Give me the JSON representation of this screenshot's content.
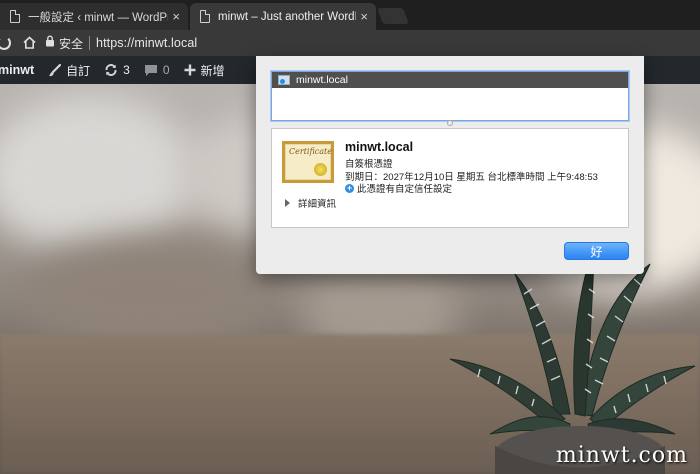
{
  "tabs": [
    {
      "title": "一般設定 ‹ minwt — WordPress",
      "close": "×",
      "active": false
    },
    {
      "title": "minwt – Just another WordPress",
      "close": "×",
      "active": true
    }
  ],
  "toolbar": {
    "secure_label": "安全",
    "url": "https://minwt.local"
  },
  "adminbar": {
    "site_name": "minwt",
    "customize_label": "自訂",
    "updates_count": "3",
    "comments_count": "0",
    "new_label": "新增"
  },
  "dialog": {
    "chain_item": "minwt.local",
    "cert": {
      "name": "minwt.local",
      "type": "自簽根憑證",
      "expiry": "到期日：2027年12月10日 星期五 台北標準時間 上午9:48:53",
      "trust": "此憑證有自定信任設定",
      "image_text": "Certificate"
    },
    "details_toggle": "詳細資訊",
    "ok_label": "好"
  },
  "watermark": "minwt.com",
  "colors": {
    "tabstrip": "#1f1f1f",
    "toolbar": "#393939",
    "adminbar": "#23282d",
    "ok_button": "#2a84f4"
  }
}
